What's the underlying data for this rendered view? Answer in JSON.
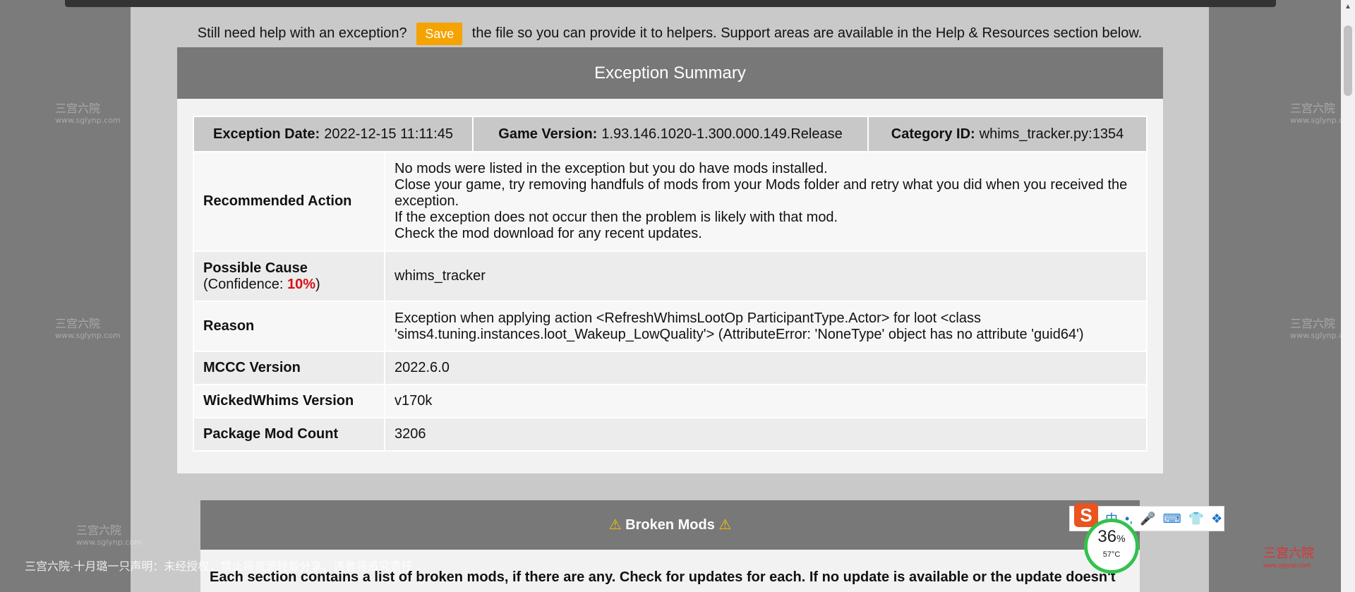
{
  "help": {
    "before": "Still need help with an exception?",
    "save_label": "Save",
    "after": "the file so you can provide it to helpers. Support areas are available in the Help & Resources section below."
  },
  "summary": {
    "title": "Exception Summary",
    "top": [
      {
        "label": "Exception Date:",
        "value": "2022-12-15 11:11:45"
      },
      {
        "label": "Game Version:",
        "value": "1.93.146.1020-1.300.000.149.Release"
      },
      {
        "label": "Category ID:",
        "value": "whims_tracker.py:1354"
      }
    ],
    "recommended_action": {
      "label": "Recommended Action",
      "lines": [
        "No mods were listed in the exception but you do have mods installed.",
        "Close your game, try removing handfuls of mods from your Mods folder and retry what you did when you received the",
        "exception.",
        "If the exception does not occur then the problem is likely with that mod.",
        "Check the mod download for any recent updates."
      ]
    },
    "possible_cause": {
      "label": "Possible Cause",
      "conf_prefix": "(Confidence: ",
      "conf_value": "10%",
      "conf_suffix": ")",
      "value": "whims_tracker"
    },
    "reason": {
      "label": "Reason",
      "lines": [
        "Exception when applying action <RefreshWhimsLootOp ParticipantType.Actor> for loot <class",
        "'sims4.tuning.instances.loot_Wakeup_LowQuality'> (AttributeError: 'NoneType' object has no attribute 'guid64')"
      ]
    },
    "mccc": {
      "label": "MCCC Version",
      "value": "2022.6.0"
    },
    "wickedwhims": {
      "label": "WickedWhims Version",
      "value": "v170k"
    },
    "package_count": {
      "label": "Package Mod Count",
      "value": "3206"
    }
  },
  "broken": {
    "warn_icon": "⚠",
    "title": "Broken Mods",
    "text": "Each section contains a list of broken mods, if there are any. Check for updates for each. If no update is available or the update doesn't"
  },
  "watermark": {
    "text": "三宫六院",
    "url": "www.sglynp.com"
  },
  "disclaimer": "三宫六院·十月璐一只声明：未经授权，禁止将资源转载分享，违者将追究责任",
  "ime": {
    "logo": "S",
    "icons": [
      "中",
      "•,",
      "🎤",
      "⌨",
      "👕",
      "❖"
    ]
  },
  "gauge": {
    "percent": "36",
    "percent_sign": "%",
    "temp": "57°C"
  },
  "corner_logo": {
    "text": "三宫六院",
    "url": "www.sglynp.com"
  },
  "colors": {
    "accent": "#f5a300",
    "header": "#787878",
    "confidence": "#d8111b"
  }
}
